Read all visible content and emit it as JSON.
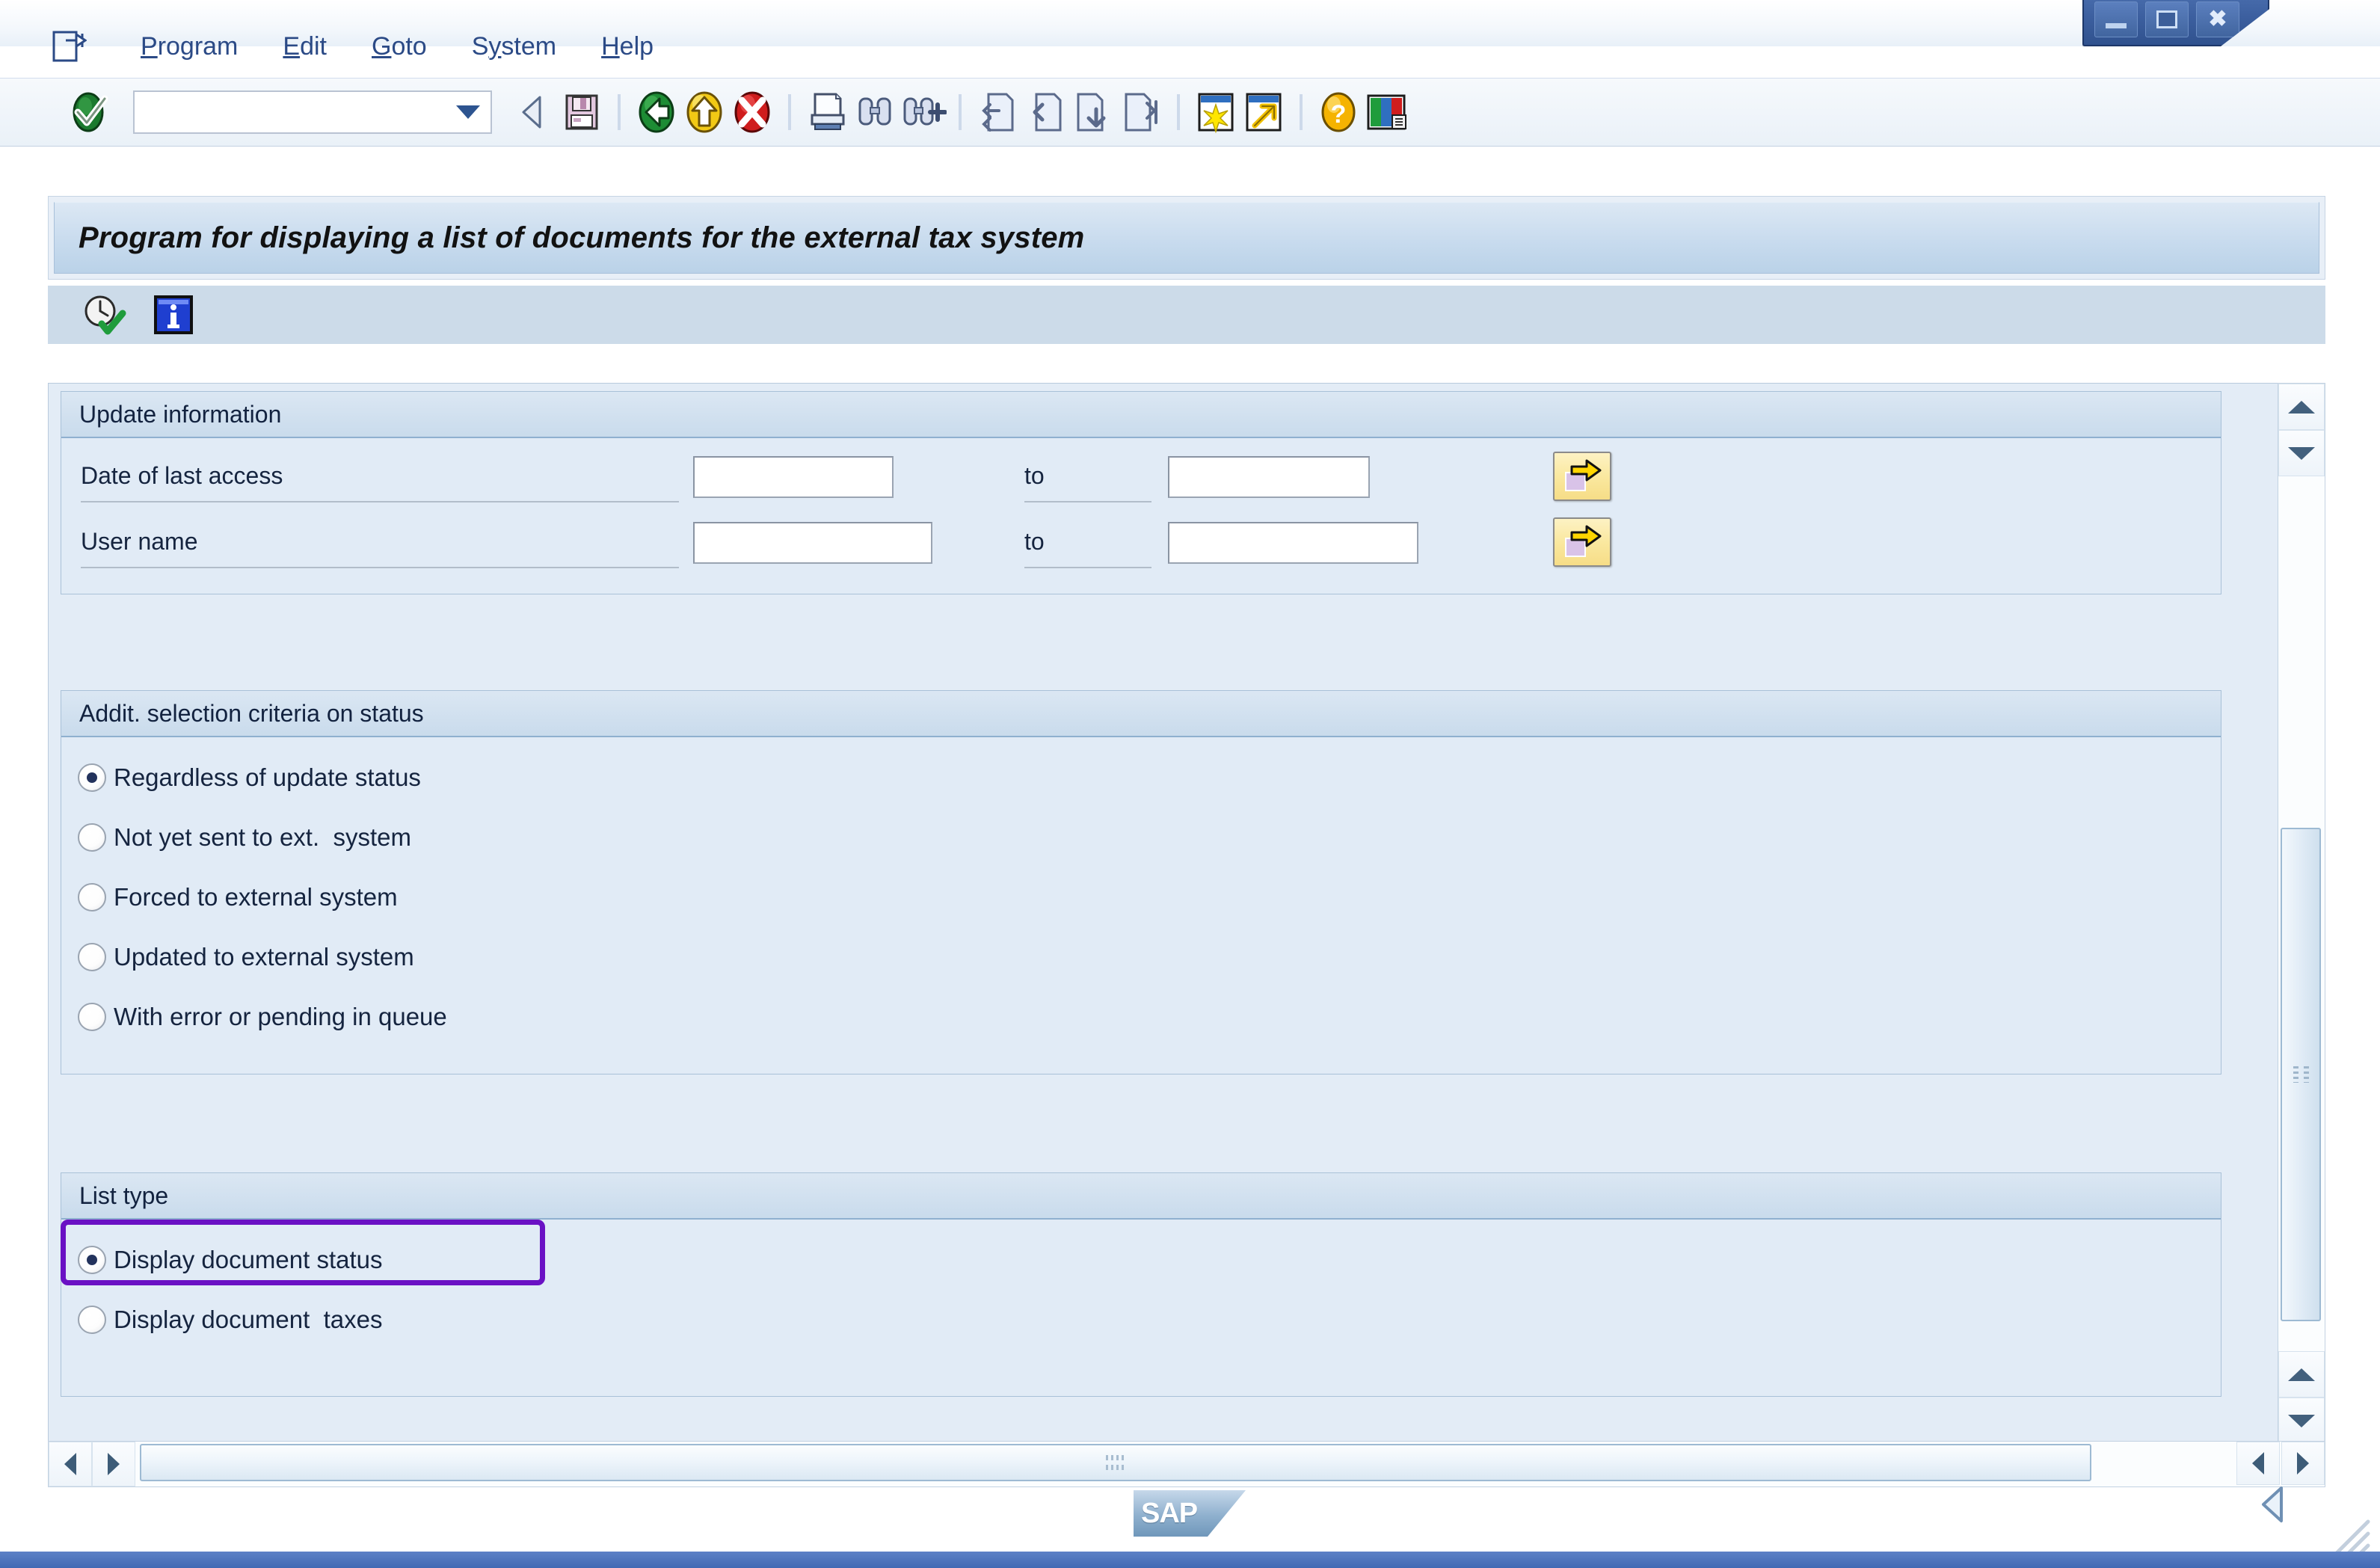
{
  "window": {
    "buttons": [
      {
        "name": "minimize",
        "glyph": "minimize-icon"
      },
      {
        "name": "maximize",
        "glyph": "maximize-icon"
      },
      {
        "name": "close",
        "glyph": "close-icon"
      }
    ]
  },
  "menubar": {
    "doc_icon": "document-exit-icon",
    "items": [
      {
        "label": "Program",
        "accel": "P"
      },
      {
        "label": "Edit",
        "accel": "E"
      },
      {
        "label": "Goto",
        "accel": "G"
      },
      {
        "label": "System",
        "accel": "y"
      },
      {
        "label": "Help",
        "accel": "H"
      }
    ]
  },
  "toolbar": {
    "enter_icon": "green-check-enter-icon",
    "command_field": {
      "value": "",
      "placeholder": ""
    },
    "dropdown_icon": "chevron-down-icon",
    "icons": [
      {
        "name": "back-arrow-icon",
        "title": "Back"
      },
      {
        "name": "save-icon",
        "title": "Save"
      },
      {
        "name": "back-green-icon",
        "title": "Back"
      },
      {
        "name": "exit-yellow-icon",
        "title": "Exit"
      },
      {
        "name": "cancel-red-icon",
        "title": "Cancel"
      },
      {
        "name": "print-icon",
        "title": "Print"
      },
      {
        "name": "find-icon",
        "title": "Find"
      },
      {
        "name": "find-next-icon",
        "title": "Find Next"
      },
      {
        "name": "first-page-icon",
        "title": "First Page"
      },
      {
        "name": "previous-page-icon",
        "title": "Previous Page"
      },
      {
        "name": "next-page-icon",
        "title": "Next Page"
      },
      {
        "name": "last-page-icon",
        "title": "Last Page"
      },
      {
        "name": "new-session-icon",
        "title": "Create New Session"
      },
      {
        "name": "shortcut-icon",
        "title": "Create Shortcut"
      },
      {
        "name": "help-icon",
        "title": "Help"
      },
      {
        "name": "layout-menu-icon",
        "title": "Customize Local Layout"
      }
    ]
  },
  "screen": {
    "title": "Program for displaying a list of documents for the external tax system",
    "app_toolbar": [
      {
        "name": "execute-icon",
        "title": "Execute"
      },
      {
        "name": "info-icon",
        "title": "Information"
      }
    ]
  },
  "groups": {
    "update_information": {
      "title": "Update information",
      "rows": [
        {
          "label": "Date of last access",
          "from_value": "",
          "to_label": "to",
          "to_value": "",
          "multi_button": "multiple-selection-icon"
        },
        {
          "label": "User name",
          "from_value": "",
          "to_label": "to",
          "to_value": "",
          "multi_button": "multiple-selection-icon"
        }
      ]
    },
    "status_criteria": {
      "title": "Addit. selection criteria on status",
      "options": [
        {
          "label": "Regardless of update status",
          "selected": true
        },
        {
          "label": "Not yet sent to ext.  system",
          "selected": false
        },
        {
          "label": "Forced to external system",
          "selected": false
        },
        {
          "label": "Updated to external system",
          "selected": false
        },
        {
          "label": "With error or pending in queue",
          "selected": false
        }
      ]
    },
    "list_type": {
      "title": "List type",
      "options": [
        {
          "label": "Display document status",
          "selected": true,
          "highlighted": true
        },
        {
          "label": "Display document  taxes",
          "selected": false,
          "highlighted": false
        }
      ]
    }
  },
  "scrollbars": {
    "vertical": {
      "up_icon": "scroll-up-icon",
      "down_icon": "scroll-down-icon"
    },
    "horizontal": {
      "left_icon": "scroll-left-icon",
      "right_icon": "scroll-right-icon"
    }
  },
  "footer": {
    "logo_text": "SAP",
    "collapse_icon": "collapse-left-icon",
    "resize_grip": "resize-grip-icon"
  },
  "colors": {
    "accent": "#4169b4",
    "highlight": "#6a11c4",
    "group_bg": "#e1ebf6",
    "title_bar": "#c8dbee"
  }
}
